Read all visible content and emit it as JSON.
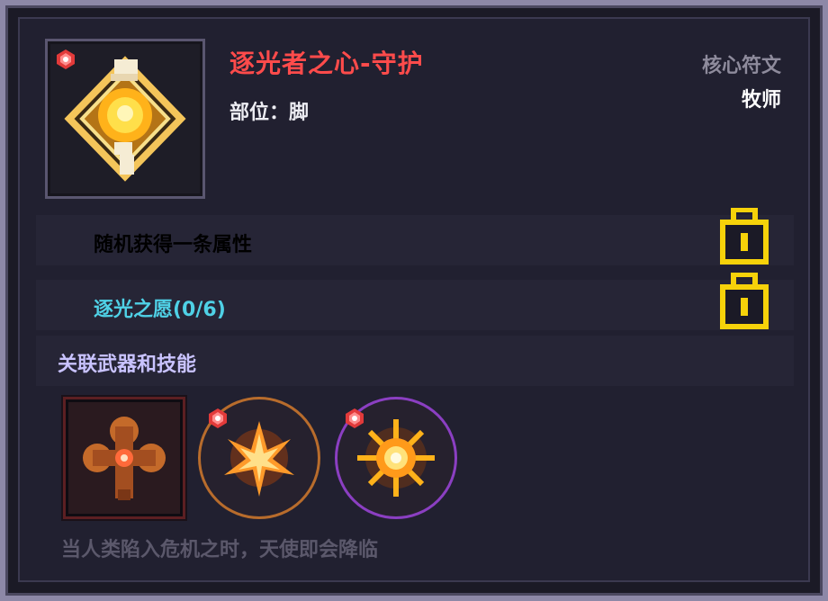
{
  "item": {
    "name": "逐光者之心-守护",
    "slot_line": "部位：脚",
    "type": "核心符文",
    "class": "牧师",
    "icon": "golden-heart-rune-icon"
  },
  "attributes": [
    {
      "text": "随机获得一条属性",
      "color": "#ececf2",
      "locked": true
    },
    {
      "text": "逐光之愿(0/6)",
      "color": "#4fd1e6",
      "locked": true
    }
  ],
  "related": {
    "title": "关联武器和技能",
    "entries": [
      {
        "icon": "cross-staff-weapon-icon",
        "frame": "square",
        "accent": "#5c1f22"
      },
      {
        "icon": "light-burst-skill-icon",
        "frame": "circle",
        "accent": "#b86c2c"
      },
      {
        "icon": "radiant-sun-skill-icon",
        "frame": "circle",
        "accent": "#8b3fc2"
      }
    ]
  },
  "flavor": "当人类陷入危机之时，天使即会降临",
  "colors": {
    "title_red": "#ff4b4b",
    "cyan": "#4fd1e6",
    "lock_gold": "#f6d20a"
  }
}
